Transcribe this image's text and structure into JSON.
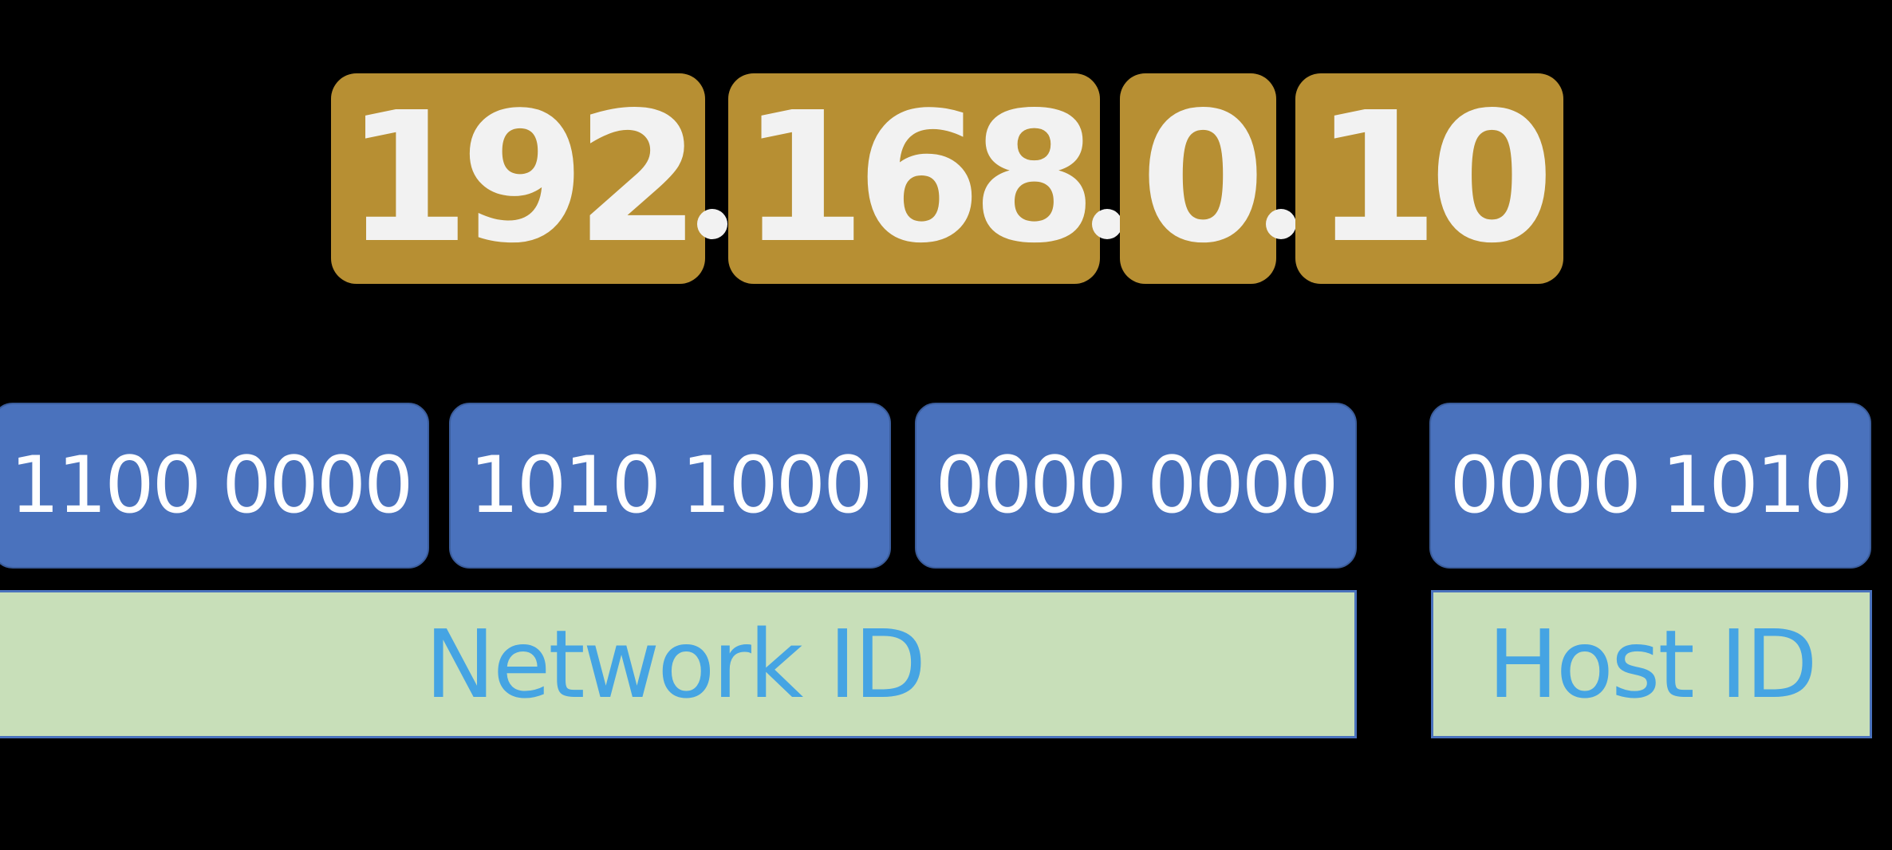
{
  "ip_address": {
    "octets": [
      "192",
      "168",
      "0",
      "10"
    ]
  },
  "binary": {
    "octets": [
      "1100 0000",
      "1010 1000",
      "0000 0000",
      "0000 1010"
    ]
  },
  "labels": {
    "network_id": "Network ID",
    "host_id": "Host ID"
  },
  "colors": {
    "background": "#000000",
    "octet_fill": "#b78f33",
    "octet_text": "#f2f2f2",
    "binary_fill": "#4a72bd",
    "binary_text": "#ffffff",
    "id_fill": "#c8dfb9",
    "id_text": "#45a4e3"
  }
}
